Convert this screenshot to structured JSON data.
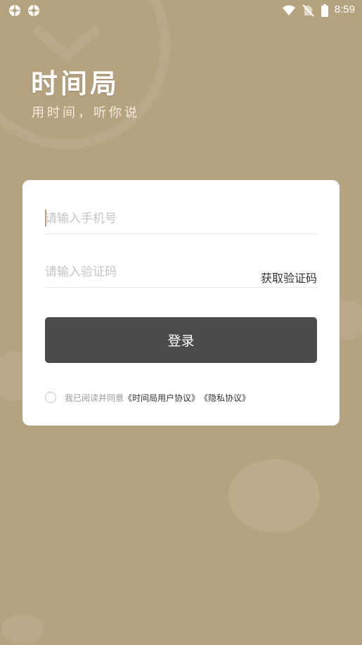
{
  "status_bar": {
    "time": "8:59",
    "left_icons": [
      "aperture-icon",
      "aperture-icon"
    ],
    "right_icons": [
      "wifi-icon",
      "no-sim-icon",
      "battery-icon"
    ]
  },
  "brand": {
    "title": "时间局",
    "subtitle": "用时间，听你说"
  },
  "login_form": {
    "phone_placeholder": "请输入手机号",
    "code_placeholder": "请输入验证码",
    "get_code_label": "获取验证码",
    "login_label": "登录",
    "agree_prefix": "我已阅读并同意",
    "user_agreement": "《时间局用户协议》",
    "privacy_policy": "《隐私协议》"
  },
  "colors": {
    "background": "#b5a27f",
    "card": "#ffffff",
    "button": "#4a4b4d"
  }
}
